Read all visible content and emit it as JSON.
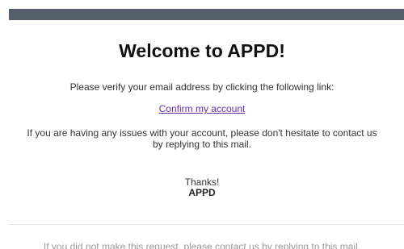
{
  "email": {
    "title": "Welcome to APPD!",
    "verify_text": "Please verify your email address by clicking the following link:",
    "confirm_link": "Confirm my account",
    "issues_line1": "If you are having any issues with your account, please don't hesitate to contact us",
    "issues_line2": "by replying to this mail.",
    "thanks": "Thanks!",
    "signature": "APPD",
    "footer": "If you did not make this request, please contact us by replying to this mail."
  },
  "colors": {
    "header_bar": "#555e6b",
    "link": "#6b2fa3",
    "footer_text": "#999999"
  }
}
